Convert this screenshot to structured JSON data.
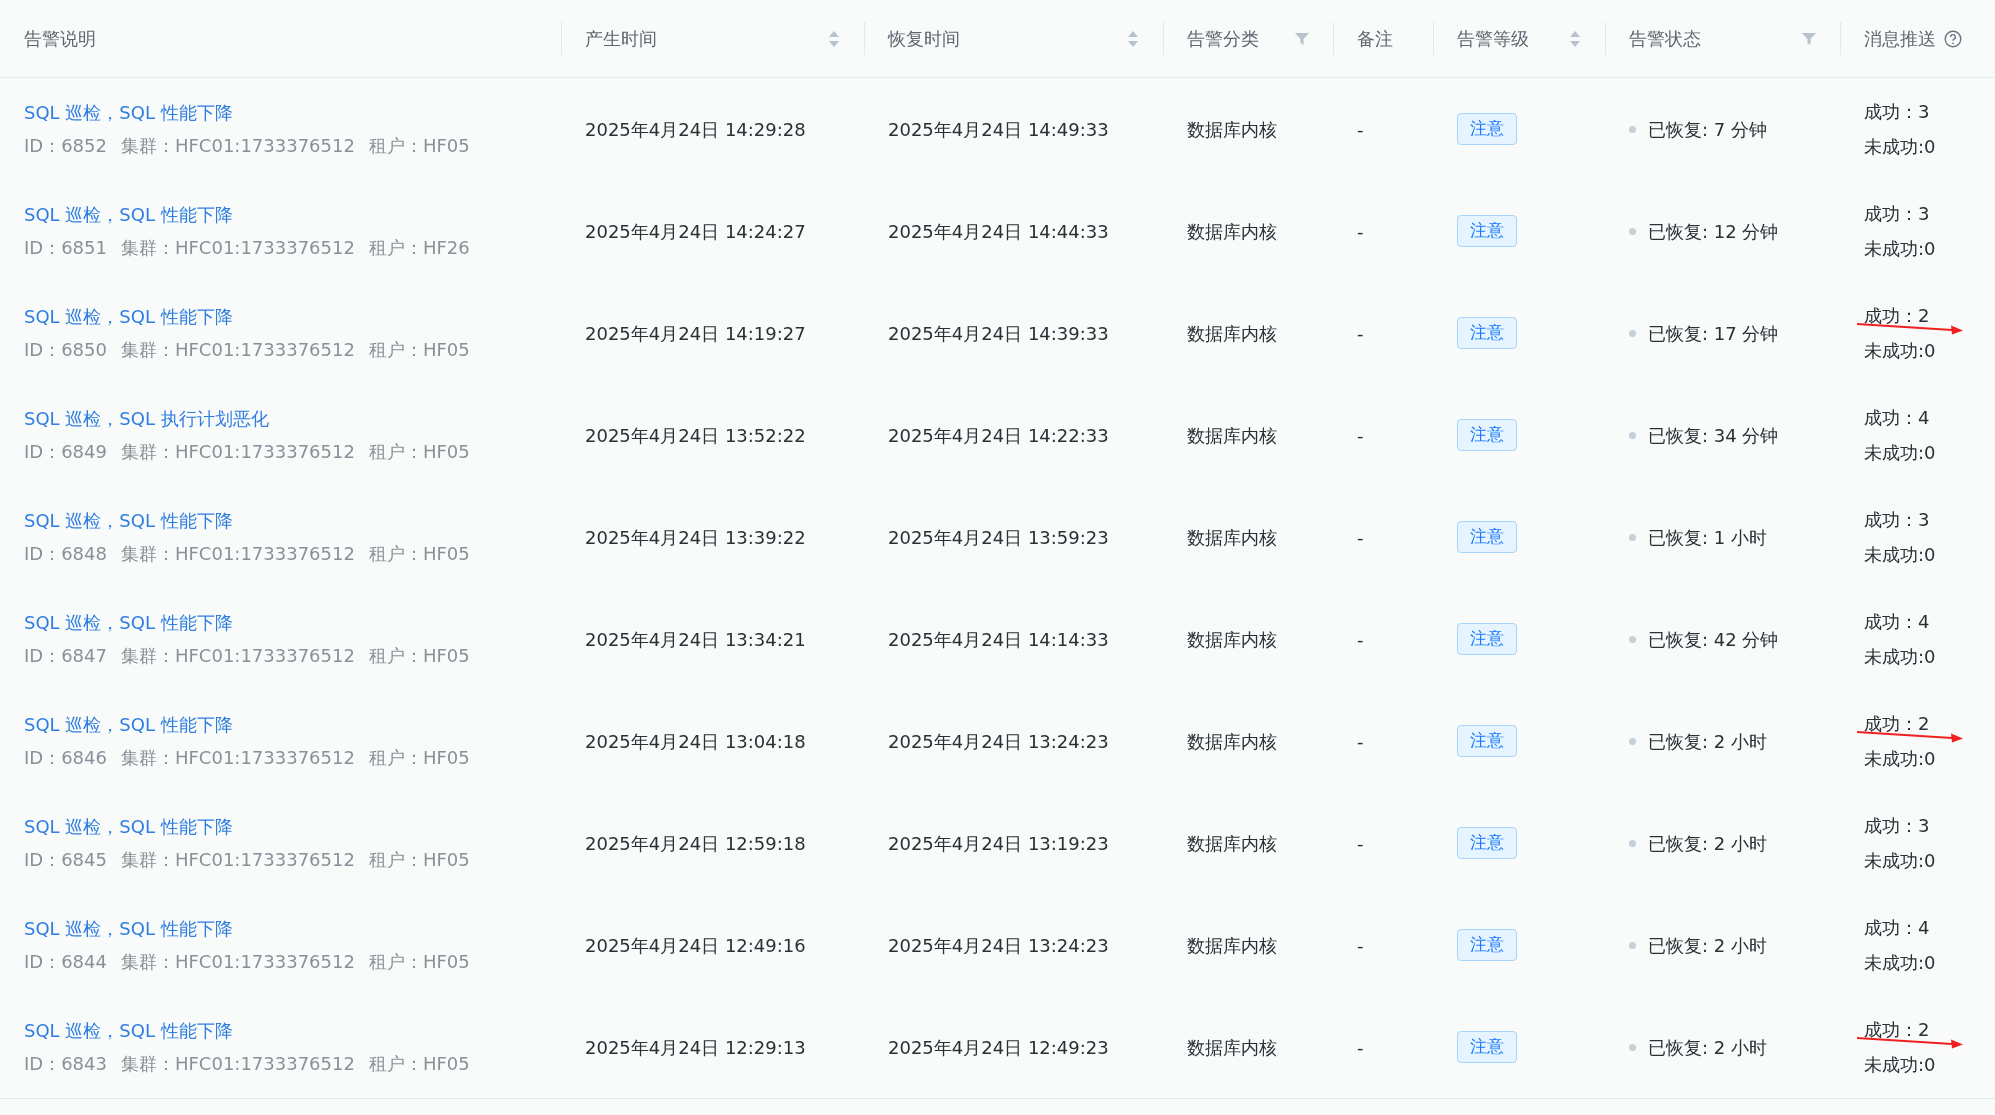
{
  "table": {
    "columns": [
      {
        "label": "告警说明",
        "kind": "none"
      },
      {
        "label": "产生时间",
        "kind": "sort"
      },
      {
        "label": "恢复时间",
        "kind": "sort"
      },
      {
        "label": "告警分类",
        "kind": "filter"
      },
      {
        "label": "备注",
        "kind": "none"
      },
      {
        "label": "告警等级",
        "kind": "sort"
      },
      {
        "label": "告警状态",
        "kind": "filter"
      },
      {
        "label": "消息推送",
        "kind": "help"
      }
    ],
    "rows": [
      {
        "title": "SQL 巡检，SQL 性能下降",
        "id": "ID：6852",
        "cluster": "集群：HFC01:1733376512",
        "tenant": "租户：HF05",
        "created": "2025年4月24日 14:29:28",
        "recovered": "2025年4月24日 14:49:33",
        "category": "数据库内核",
        "note": "-",
        "level": "注意",
        "status": "已恢复: 7 分钟",
        "success": "成功：3",
        "failed": "未成功:0",
        "marked": false
      },
      {
        "title": "SQL 巡检，SQL 性能下降",
        "id": "ID：6851",
        "cluster": "集群：HFC01:1733376512",
        "tenant": "租户：HF26",
        "created": "2025年4月24日 14:24:27",
        "recovered": "2025年4月24日 14:44:33",
        "category": "数据库内核",
        "note": "-",
        "level": "注意",
        "status": "已恢复: 12 分钟",
        "success": "成功：3",
        "failed": "未成功:0",
        "marked": false
      },
      {
        "title": "SQL 巡检，SQL 性能下降",
        "id": "ID：6850",
        "cluster": "集群：HFC01:1733376512",
        "tenant": "租户：HF05",
        "created": "2025年4月24日 14:19:27",
        "recovered": "2025年4月24日 14:39:33",
        "category": "数据库内核",
        "note": "-",
        "level": "注意",
        "status": "已恢复: 17 分钟",
        "success": "成功：2",
        "failed": "未成功:0",
        "marked": true
      },
      {
        "title": "SQL 巡检，SQL 执行计划恶化",
        "id": "ID：6849",
        "cluster": "集群：HFC01:1733376512",
        "tenant": "租户：HF05",
        "created": "2025年4月24日 13:52:22",
        "recovered": "2025年4月24日 14:22:33",
        "category": "数据库内核",
        "note": "-",
        "level": "注意",
        "status": "已恢复: 34 分钟",
        "success": "成功：4",
        "failed": "未成功:0",
        "marked": false
      },
      {
        "title": "SQL 巡检，SQL 性能下降",
        "id": "ID：6848",
        "cluster": "集群：HFC01:1733376512",
        "tenant": "租户：HF05",
        "created": "2025年4月24日 13:39:22",
        "recovered": "2025年4月24日 13:59:23",
        "category": "数据库内核",
        "note": "-",
        "level": "注意",
        "status": "已恢复: 1 小时",
        "success": "成功：3",
        "failed": "未成功:0",
        "marked": false
      },
      {
        "title": "SQL 巡检，SQL 性能下降",
        "id": "ID：6847",
        "cluster": "集群：HFC01:1733376512",
        "tenant": "租户：HF05",
        "created": "2025年4月24日 13:34:21",
        "recovered": "2025年4月24日 14:14:33",
        "category": "数据库内核",
        "note": "-",
        "level": "注意",
        "status": "已恢复: 42 分钟",
        "success": "成功：4",
        "failed": "未成功:0",
        "marked": false
      },
      {
        "title": "SQL 巡检，SQL 性能下降",
        "id": "ID：6846",
        "cluster": "集群：HFC01:1733376512",
        "tenant": "租户：HF05",
        "created": "2025年4月24日 13:04:18",
        "recovered": "2025年4月24日 13:24:23",
        "category": "数据库内核",
        "note": "-",
        "level": "注意",
        "status": "已恢复: 2 小时",
        "success": "成功：2",
        "failed": "未成功:0",
        "marked": true
      },
      {
        "title": "SQL 巡检，SQL 性能下降",
        "id": "ID：6845",
        "cluster": "集群：HFC01:1733376512",
        "tenant": "租户：HF05",
        "created": "2025年4月24日 12:59:18",
        "recovered": "2025年4月24日 13:19:23",
        "category": "数据库内核",
        "note": "-",
        "level": "注意",
        "status": "已恢复: 2 小时",
        "success": "成功：3",
        "failed": "未成功:0",
        "marked": false
      },
      {
        "title": "SQL 巡检，SQL 性能下降",
        "id": "ID：6844",
        "cluster": "集群：HFC01:1733376512",
        "tenant": "租户：HF05",
        "created": "2025年4月24日 12:49:16",
        "recovered": "2025年4月24日 13:24:23",
        "category": "数据库内核",
        "note": "-",
        "level": "注意",
        "status": "已恢复: 2 小时",
        "success": "成功：4",
        "failed": "未成功:0",
        "marked": false
      },
      {
        "title": "SQL 巡检，SQL 性能下降",
        "id": "ID：6843",
        "cluster": "集群：HFC01:1733376512",
        "tenant": "租户：HF05",
        "created": "2025年4月24日 12:29:13",
        "recovered": "2025年4月24日 12:49:23",
        "category": "数据库内核",
        "note": "-",
        "level": "注意",
        "status": "已恢复: 2 小时",
        "success": "成功：2",
        "failed": "未成功:0",
        "marked": true
      }
    ]
  }
}
